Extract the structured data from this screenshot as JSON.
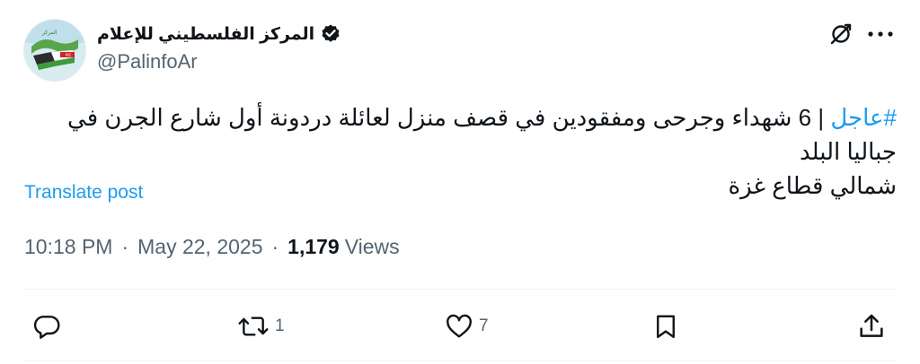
{
  "author": {
    "name": "المركز الفلسطيني للإعلام",
    "handle": "@PalinfoAr",
    "verified": true,
    "avatar_icon": "palinfo-logo-icon"
  },
  "header_actions": {
    "grok_icon": "grok-icon",
    "more_icon": "more-dots-icon"
  },
  "post": {
    "hashtag": "#عاجل",
    "text_line1": " | 6 شهداء وجرحى ومفقودين في قصف منزل لعائلة دردونة أول شارع الجرن في جباليا البلد",
    "text_line2": "شمالي قطاع غزة",
    "translate_label": "Translate post"
  },
  "meta": {
    "time": "10:18 PM",
    "date": "May 22, 2025",
    "views_count": "1,179",
    "views_label": "Views"
  },
  "actions": {
    "reply": {
      "icon": "reply-icon",
      "count": ""
    },
    "repost": {
      "icon": "repost-icon",
      "count": "1"
    },
    "like": {
      "icon": "heart-icon",
      "count": "7"
    },
    "bookmark": {
      "icon": "bookmark-icon",
      "count": ""
    },
    "share": {
      "icon": "share-icon",
      "count": ""
    }
  },
  "colors": {
    "accent": "#1d9bf0",
    "text": "#0f1419",
    "secondary": "#536471"
  }
}
